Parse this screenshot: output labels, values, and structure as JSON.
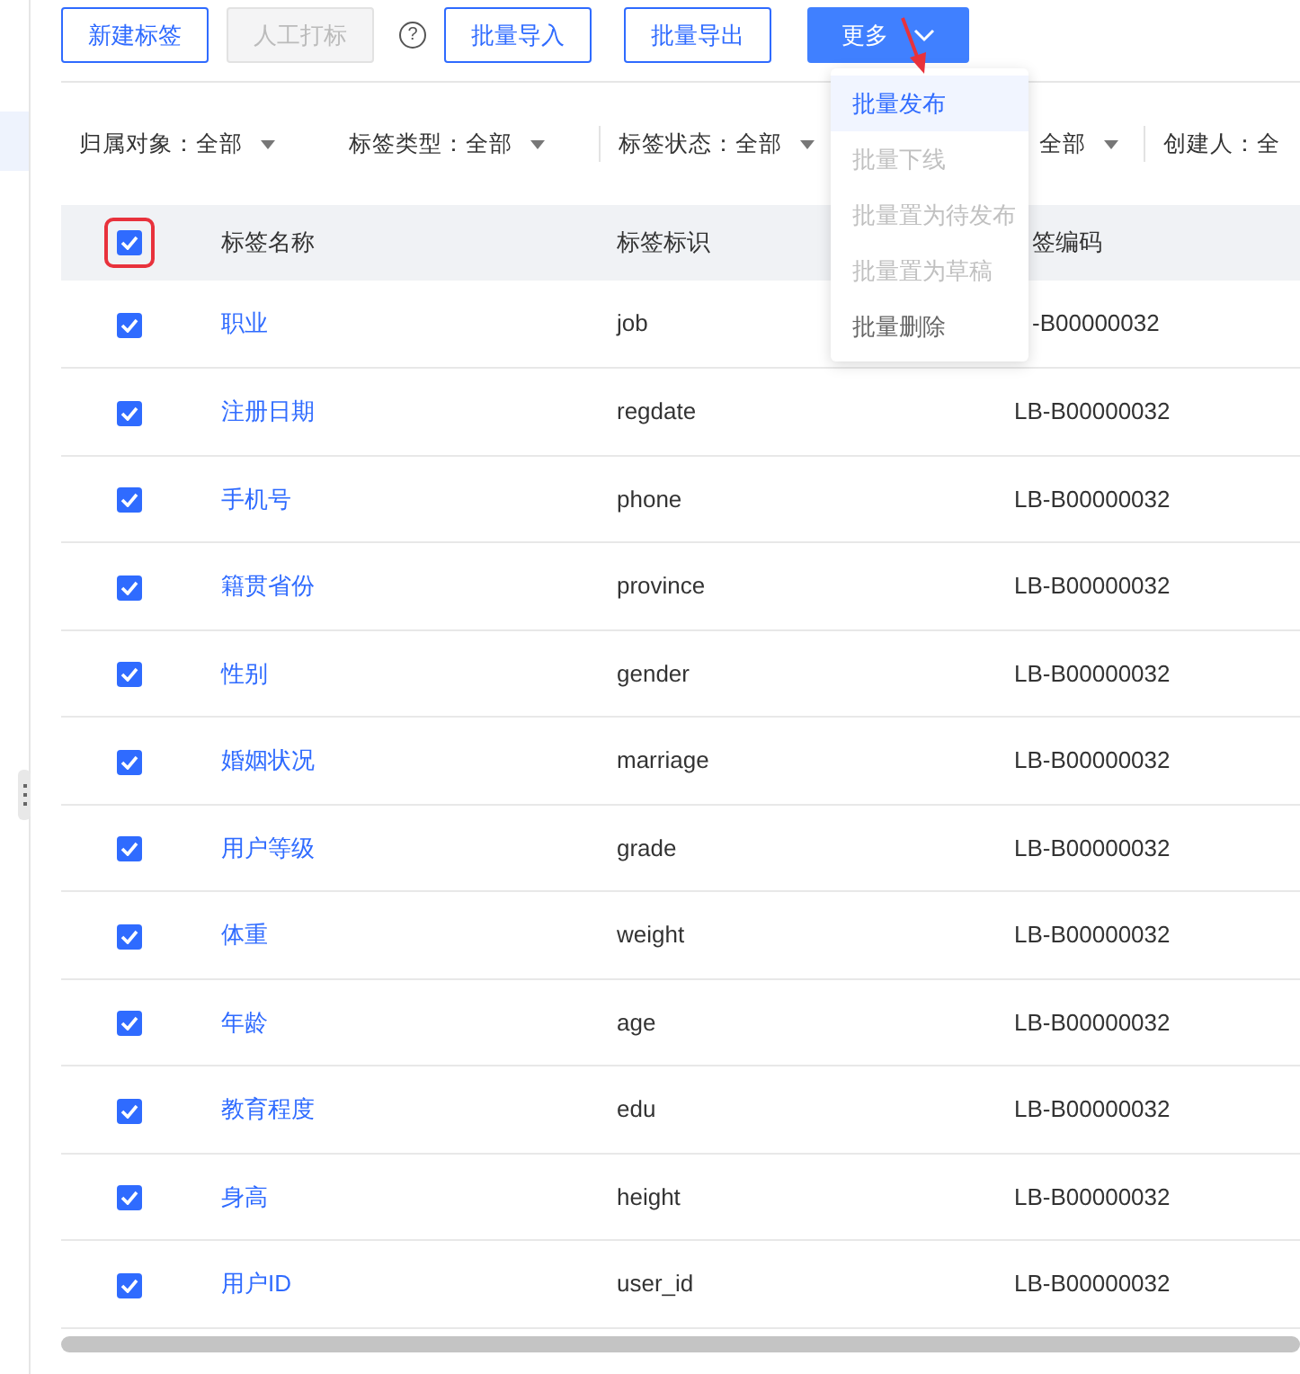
{
  "toolbar": {
    "buttons": [
      {
        "label": "新建标签",
        "kind": "outline",
        "disabled": false
      },
      {
        "label": "人工打标",
        "kind": "outline",
        "disabled": true
      },
      {
        "label": "?",
        "kind": "help",
        "disabled": false
      },
      {
        "label": "批量导入",
        "kind": "outline",
        "disabled": false
      },
      {
        "label": "批量导出",
        "kind": "outline",
        "disabled": false
      },
      {
        "label": "更多",
        "kind": "primary",
        "disabled": false
      }
    ]
  },
  "more_menu": {
    "items": [
      {
        "label": "批量发布",
        "selected": true,
        "disabled": false
      },
      {
        "label": "批量下线",
        "selected": false,
        "disabled": true
      },
      {
        "label": "批量置为待发布",
        "selected": false,
        "disabled": true
      },
      {
        "label": "批量置为草稿",
        "selected": false,
        "disabled": true
      },
      {
        "label": "批量删除",
        "selected": false,
        "disabled": false
      }
    ]
  },
  "filters": [
    {
      "label": "归属对象：",
      "value": "全部",
      "divider_before": false
    },
    {
      "label": "标签类型：",
      "value": "全部",
      "divider_before": false
    },
    {
      "label": "标签状态：",
      "value": "全部",
      "divider_before": true
    },
    {
      "value": "全部",
      "divider_before": false
    },
    {
      "label": "创建人：",
      "value": "全",
      "divider_before": true
    }
  ],
  "table": {
    "all_checked": true,
    "columns": [
      "标签名称",
      "标签标识",
      "签编码"
    ],
    "rows": [
      {
        "checked": true,
        "name": "职业",
        "key": "job",
        "code": "-B00000032"
      },
      {
        "checked": true,
        "name": "注册日期",
        "key": "regdate",
        "code": "LB-B00000032"
      },
      {
        "checked": true,
        "name": "手机号",
        "key": "phone",
        "code": "LB-B00000032"
      },
      {
        "checked": true,
        "name": "籍贯省份",
        "key": "province",
        "code": "LB-B00000032"
      },
      {
        "checked": true,
        "name": "性别",
        "key": "gender",
        "code": "LB-B00000032"
      },
      {
        "checked": true,
        "name": "婚姻状况",
        "key": "marriage",
        "code": "LB-B00000032"
      },
      {
        "checked": true,
        "name": "用户等级",
        "key": "grade",
        "code": "LB-B00000032"
      },
      {
        "checked": true,
        "name": "体重",
        "key": "weight",
        "code": "LB-B00000032"
      },
      {
        "checked": true,
        "name": "年龄",
        "key": "age",
        "code": "LB-B00000032"
      },
      {
        "checked": true,
        "name": "教育程度",
        "key": "edu",
        "code": "LB-B00000032"
      },
      {
        "checked": true,
        "name": "身高",
        "key": "height",
        "code": "LB-B00000032"
      },
      {
        "checked": true,
        "name": "用户ID",
        "key": "user_id",
        "code": "LB-B00000032"
      }
    ]
  }
}
